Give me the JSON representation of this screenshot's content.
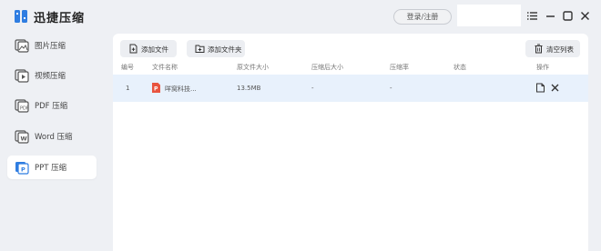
{
  "app": {
    "title": "迅捷压缩",
    "login_label": "登录/注册"
  },
  "sidebar": {
    "items": [
      {
        "label": "图片压缩",
        "icon": "image-compress-icon",
        "active": false
      },
      {
        "label": "视频压缩",
        "icon": "video-compress-icon",
        "active": false
      },
      {
        "label": "PDF 压缩",
        "icon": "pdf-compress-icon",
        "active": false
      },
      {
        "label": "Word 压缩",
        "icon": "word-compress-icon",
        "active": false
      },
      {
        "label": "PPT 压缩",
        "icon": "ppt-compress-icon",
        "active": true
      }
    ]
  },
  "toolbar": {
    "add_file_label": "添加文件",
    "add_folder_label": "添加文件夹",
    "clear_list_label": "清空列表"
  },
  "table": {
    "columns": [
      "编号",
      "文件名称",
      "原文件大小",
      "压缩后大小",
      "压缩率",
      "状态",
      "操作"
    ],
    "rows": [
      {
        "index": "1",
        "name": "咩窝科技...",
        "original_size": "13.5MB",
        "compressed_size": "-",
        "ratio": "-",
        "status": ""
      }
    ]
  },
  "colors": {
    "accent": "#2f7de1",
    "ppt": "#e8543f",
    "row_highlight": "#e8f1fc",
    "background": "#eef0f4"
  }
}
